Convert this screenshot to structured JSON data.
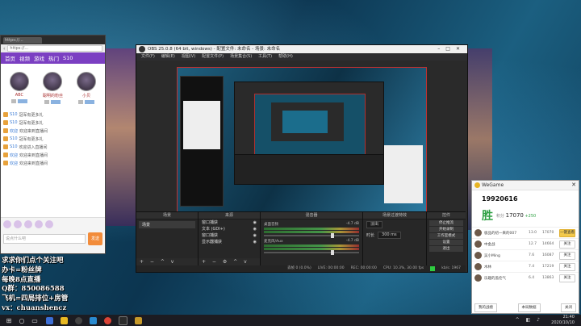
{
  "browser": {
    "tab_title": "https://...",
    "url": "https://...",
    "nav": [
      "首页",
      "视频",
      "游戏",
      "热门",
      "S10"
    ],
    "streamers": [
      {
        "name": "ABC"
      },
      {
        "name": "聪明的粉丝"
      },
      {
        "name": "小贝"
      }
    ],
    "chat": [
      {
        "nick": "S10",
        "msg": "冠军有更多礼"
      },
      {
        "nick": "S10",
        "msg": "冠军有更多礼"
      },
      {
        "nick": "欢迎",
        "msg": "欢迎来到直播间"
      },
      {
        "nick": "S10",
        "msg": "冠军有更多礼"
      },
      {
        "nick": "S10",
        "msg": "欢迎进入直播间"
      },
      {
        "nick": "欢迎",
        "msg": "欢迎来到直播间"
      },
      {
        "nick": "欢迎",
        "msg": "欢迎来到直播间"
      }
    ],
    "input_placeholder": "说点什么吧",
    "send_label": "发送"
  },
  "obs": {
    "title": "OBS 25.0.8 (64 bit, windows) - 配置文件: 未命名 - 场景: 未命名",
    "menu": [
      "文件(F)",
      "编辑(E)",
      "视图(V)",
      "配置文件(P)",
      "场景集合(S)",
      "工具(T)",
      "帮助(H)"
    ],
    "docks": {
      "scenes": "场景",
      "sources": "来源",
      "mixer": "混音器",
      "transitions": "场景过渡特效",
      "controls": "控件"
    },
    "scene_items": [
      "场景"
    ],
    "source_items": [
      "窗口捕获",
      "文本 (GDI+)",
      "窗口捕获",
      "显示器捕获"
    ],
    "mixer_channels": [
      {
        "name": "桌面音频",
        "db": "-4.7 dB"
      },
      {
        "name": "麦克风/Aux",
        "db": "-4.7 dB"
      }
    ],
    "transition": {
      "type": "淡出",
      "duration_label": "时长",
      "duration": "300 ms"
    },
    "controls": [
      "停止推流",
      "开始录制",
      "工作室模式",
      "设置",
      "退出"
    ],
    "status": [
      "丢帧 0 (0.0%)",
      "LIVE: 00:00:00",
      "REC: 00:00:00",
      "CPU: 10.3%, 30.00 fps",
      "kb/s: 1967"
    ]
  },
  "overlay": {
    "lines": [
      "求求你们点个关注吧",
      "办卡=粉丝牌",
      "每晚8点直播",
      "Q群：850086588",
      "飞机=四局排位+房管",
      "vx：chuanshencz"
    ]
  },
  "wegame": {
    "title": "WeGame",
    "user_id": "19920616",
    "result": "胜",
    "score_label": "积分",
    "score": "17070",
    "score_delta": "+250",
    "players": [
      {
        "name": "极品的初一来的007",
        "score": "13.0",
        "points": "17070",
        "action": "一键查看",
        "gold": true
      },
      {
        "name": "中金战",
        "score": "12.7",
        "points": "14664",
        "action": "关注",
        "gold": false
      },
      {
        "name": "吴小Ming",
        "score": "7.6",
        "points": "16087",
        "action": "关注",
        "gold": false
      },
      {
        "name": "木林",
        "score": "7.4",
        "points": "17219",
        "action": "关注",
        "gold": false
      },
      {
        "name": "乐趣的盖伦气",
        "score": "6.4",
        "points": "13863",
        "action": "关注",
        "gold": false
      }
    ],
    "footer": [
      "我的战绩",
      "本局数据",
      "关闭"
    ]
  },
  "taskbar": {
    "time": "21:40",
    "date": "2020/10/10"
  }
}
